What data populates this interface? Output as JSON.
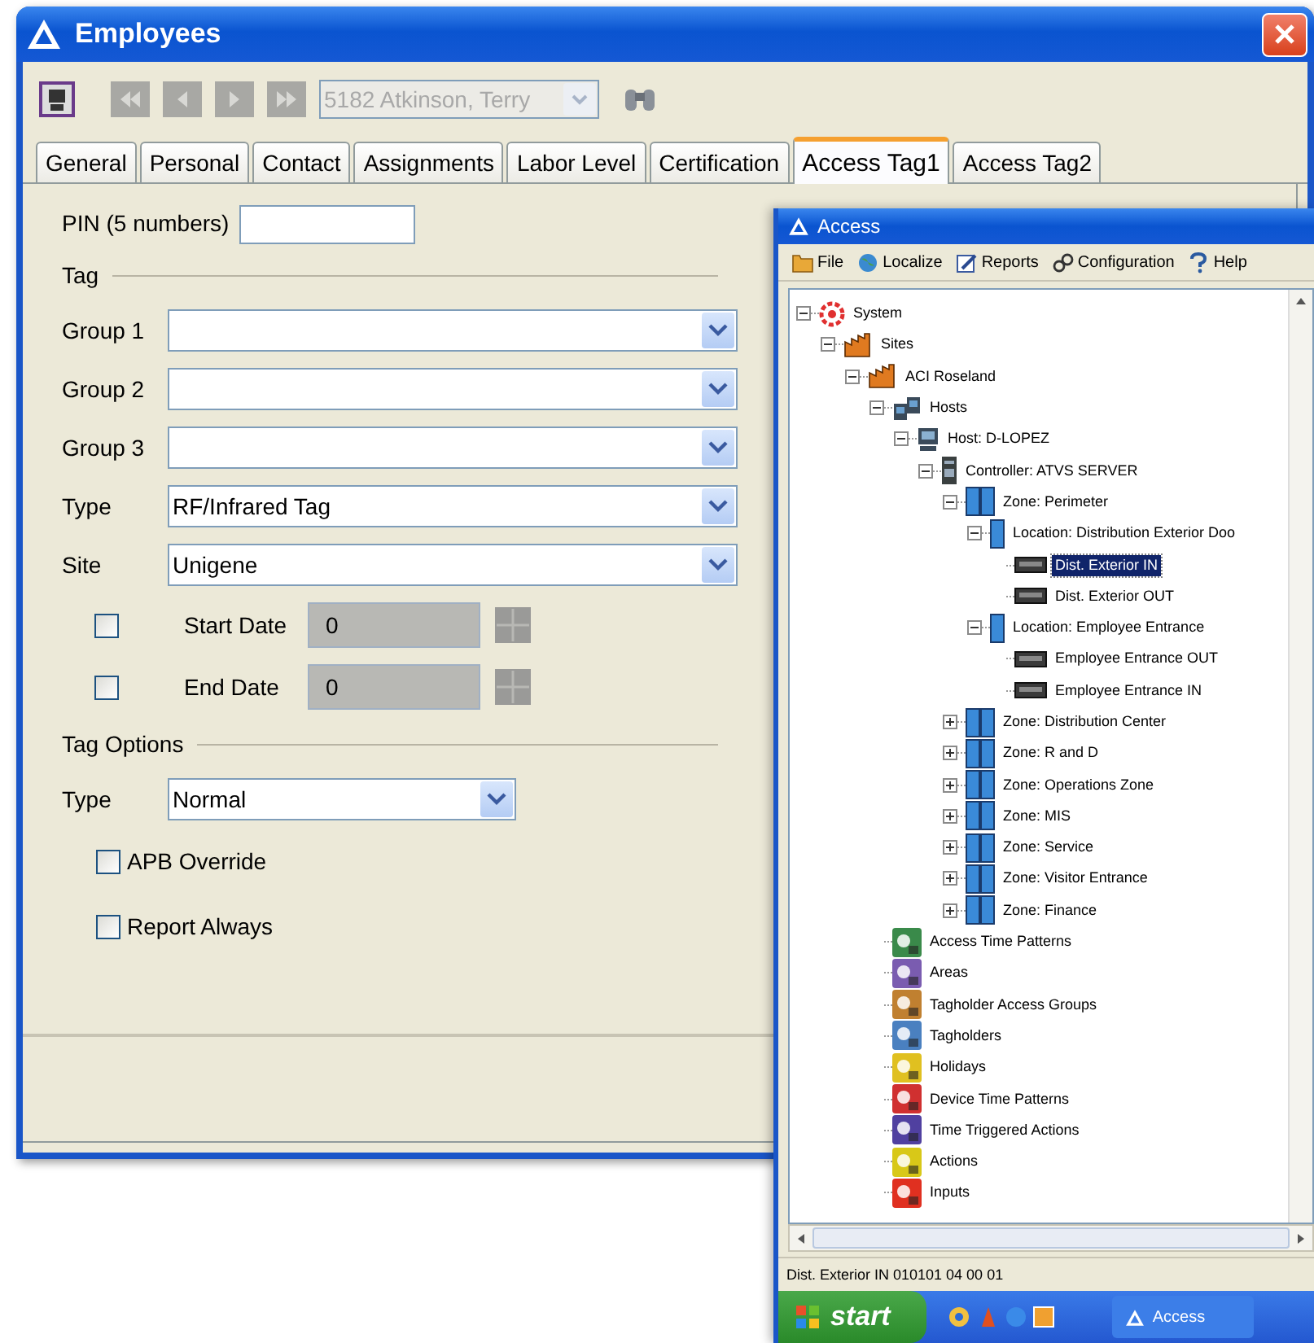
{
  "employees": {
    "title": "Employees",
    "toolbar": {
      "nav_buttons": [
        {
          "kind": "first",
          "disabled": true
        },
        {
          "kind": "prev",
          "disabled": true
        },
        {
          "kind": "next",
          "disabled": true
        },
        {
          "kind": "last",
          "disabled": true
        }
      ],
      "employee": {
        "value": "5182 Atkinson, Terry",
        "disabled": true
      }
    },
    "tabs": [
      {
        "label": "General",
        "selected": false
      },
      {
        "label": "Personal",
        "selected": false
      },
      {
        "label": "Contact",
        "selected": false
      },
      {
        "label": "Assignments",
        "selected": false
      },
      {
        "label": "Labor Level",
        "selected": false
      },
      {
        "label": "Certification",
        "selected": false
      },
      {
        "label": "Access Tag1",
        "selected": true
      },
      {
        "label": "Access Tag2",
        "selected": false
      }
    ],
    "form": {
      "pin_label": "PIN (5 numbers)",
      "tag_section": "Tag",
      "selects": [
        {
          "label": "Group 1"
        },
        {
          "label": "Group 2"
        },
        {
          "label": "Group 3"
        },
        {
          "label": "Type",
          "value": "RF/Infrared Tag"
        },
        {
          "label": "Site",
          "value": "Unigene"
        }
      ],
      "dates": [
        {
          "label": "Start Date",
          "checked": false,
          "value": "0",
          "disabled": true
        },
        {
          "label": "End Date",
          "checked": false,
          "value": "0",
          "disabled": true
        }
      ],
      "options_section": "Tag Options",
      "option_type": {
        "label": "Type",
        "value": "Normal"
      },
      "checkboxes": [
        {
          "label": "APB Override",
          "checked": false
        },
        {
          "label": "Report Always",
          "checked": false
        }
      ]
    }
  },
  "access": {
    "title": "Access",
    "menu": [
      {
        "label": "File",
        "kind": "folder"
      },
      {
        "label": "Localize",
        "kind": "globe"
      },
      {
        "label": "Reports",
        "kind": "report"
      },
      {
        "label": "Configuration",
        "kind": "links"
      },
      {
        "label": "Help",
        "kind": "help"
      }
    ],
    "tree": [
      {
        "label": "System",
        "kind": "system",
        "expanded": true,
        "selected": false,
        "children": [
          {
            "label": "Sites",
            "kind": "site",
            "expanded": true,
            "selected": false,
            "children": [
              {
                "label": "ACI Roseland",
                "kind": "site",
                "expanded": true,
                "selected": false,
                "children": [
                  {
                    "label": "Hosts",
                    "kind": "hosts",
                    "expanded": true,
                    "selected": false,
                    "children": [
                      {
                        "label": "Host: D-LOPEZ",
                        "kind": "host",
                        "expanded": true,
                        "selected": false,
                        "children": [
                          {
                            "label": "Controller: ATVS SERVER",
                            "kind": "controller",
                            "expanded": true,
                            "selected": false,
                            "children": [
                              {
                                "label": "Zone: Perimeter",
                                "kind": "zone",
                                "expanded": true,
                                "selected": false,
                                "children": [
                                  {
                                    "label": "Location: Distribution Exterior Doo",
                                    "kind": "location",
                                    "expanded": true,
                                    "selected": false,
                                    "children": [
                                      {
                                        "label": "Dist. Exterior IN",
                                        "kind": "reader",
                                        "selected": true
                                      },
                                      {
                                        "label": "Dist. Exterior OUT",
                                        "kind": "reader",
                                        "selected": false
                                      }
                                    ]
                                  },
                                  {
                                    "label": "Location: Employee Entrance",
                                    "kind": "location",
                                    "expanded": true,
                                    "selected": false,
                                    "children": [
                                      {
                                        "label": "Employee Entrance OUT",
                                        "kind": "reader",
                                        "selected": false
                                      },
                                      {
                                        "label": "Employee Entrance IN",
                                        "kind": "reader",
                                        "selected": false
                                      }
                                    ]
                                  }
                                ]
                              },
                              {
                                "label": "Zone: Distribution Center",
                                "kind": "zone",
                                "expanded": false,
                                "selected": false
                              },
                              {
                                "label": "Zone: R and D",
                                "kind": "zone",
                                "expanded": false,
                                "selected": false
                              },
                              {
                                "label": "Zone: Operations Zone",
                                "kind": "zone",
                                "expanded": false,
                                "selected": false
                              },
                              {
                                "label": "Zone: MIS",
                                "kind": "zone",
                                "expanded": false,
                                "selected": false
                              },
                              {
                                "label": "Zone: Service",
                                "kind": "zone",
                                "expanded": false,
                                "selected": false
                              },
                              {
                                "label": "Zone: Visitor Entrance",
                                "kind": "zone",
                                "expanded": false,
                                "selected": false
                              },
                              {
                                "label": "Zone: Finance",
                                "kind": "zone",
                                "expanded": false,
                                "selected": false
                              }
                            ]
                          }
                        ]
                      }
                    ]
                  },
                  {
                    "label": "Access Time Patterns",
                    "kind": "category",
                    "color": "#3a8a4a",
                    "selected": false
                  },
                  {
                    "label": "Areas",
                    "kind": "category",
                    "color": "#7a5cb0",
                    "selected": false
                  },
                  {
                    "label": "Tagholder Access Groups",
                    "kind": "category",
                    "color": "#c08030",
                    "selected": false
                  },
                  {
                    "label": "Tagholders",
                    "kind": "category",
                    "color": "#4a80c0",
                    "selected": false
                  },
                  {
                    "label": "Holidays",
                    "kind": "category",
                    "color": "#e0c020",
                    "selected": false
                  },
                  {
                    "label": "Device Time Patterns",
                    "kind": "category",
                    "color": "#d03030",
                    "selected": false
                  },
                  {
                    "label": "Time Triggered Actions",
                    "kind": "category",
                    "color": "#5040a0",
                    "selected": false
                  },
                  {
                    "label": "Actions",
                    "kind": "category",
                    "color": "#d8c818",
                    "selected": false
                  },
                  {
                    "label": "Inputs",
                    "kind": "category",
                    "color": "#e03020",
                    "selected": false
                  }
                ]
              }
            ]
          }
        ]
      }
    ],
    "status": "Dist. Exterior IN 010101 04 00 01"
  },
  "taskbar": {
    "start": "start",
    "tasks": [
      {
        "label": "Access"
      }
    ]
  }
}
